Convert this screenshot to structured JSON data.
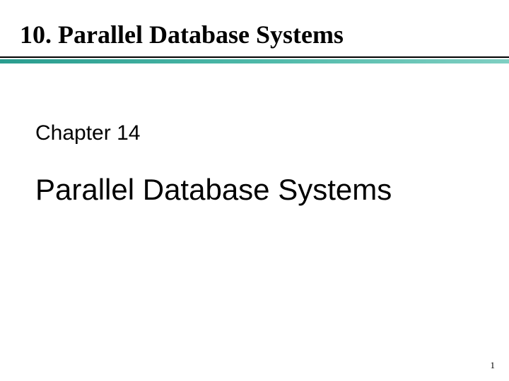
{
  "slide": {
    "title": "10.  Parallel Database Systems",
    "chapter_label": "Chapter 14",
    "main_topic": "Parallel Database Systems",
    "page_number": "1"
  },
  "colors": {
    "divider_accent": "#2a9d8f"
  }
}
